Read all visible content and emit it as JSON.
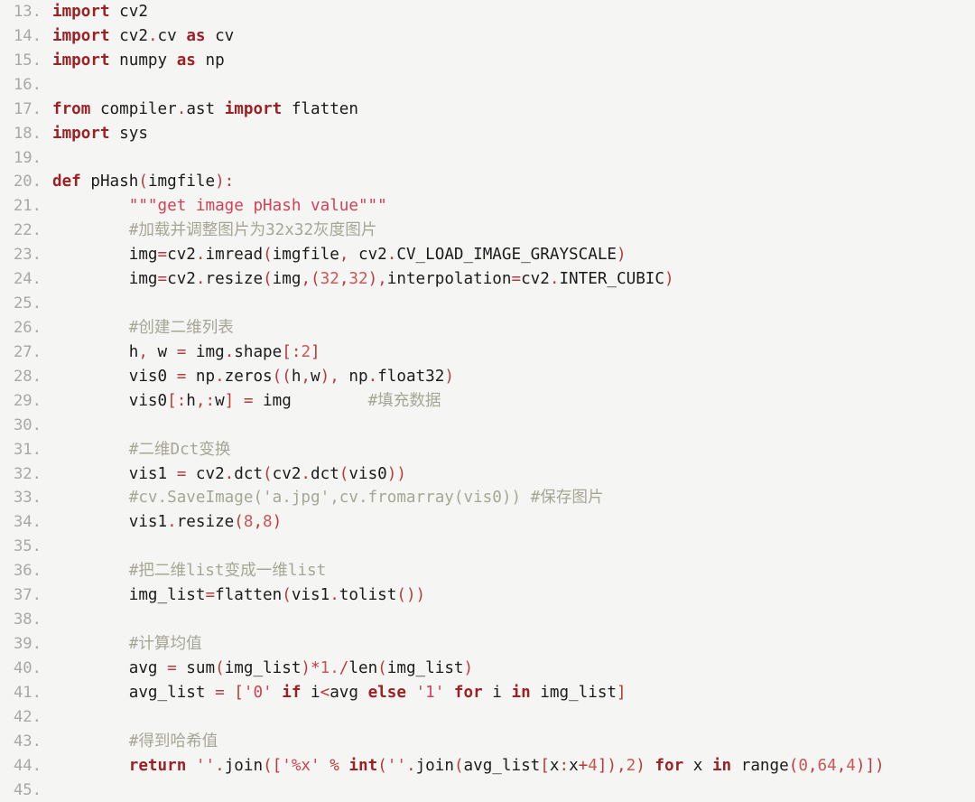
{
  "editor": {
    "language": "python",
    "background_color": "#f5f5f4",
    "line_number_color": "#a8a8a8",
    "keyword_color": "#9c2125",
    "string_color": "#cf4256",
    "comment_color": "#a6a695",
    "number_color": "#cc5555",
    "operator_color": "#b83b3b",
    "plain_color": "#1b1b1b",
    "first_line_number": 13,
    "last_line_number": 45
  },
  "lines": [
    {
      "n": "13.",
      "tokens": [
        {
          "t": "kw",
          "v": "import"
        },
        {
          "t": "pl",
          "v": " cv2"
        }
      ]
    },
    {
      "n": "14.",
      "tokens": [
        {
          "t": "kw",
          "v": "import"
        },
        {
          "t": "pl",
          "v": " cv2"
        },
        {
          "t": "op",
          "v": "."
        },
        {
          "t": "pl",
          "v": "cv "
        },
        {
          "t": "kw",
          "v": "as"
        },
        {
          "t": "pl",
          "v": " cv"
        }
      ]
    },
    {
      "n": "15.",
      "tokens": [
        {
          "t": "kw",
          "v": "import"
        },
        {
          "t": "pl",
          "v": " numpy "
        },
        {
          "t": "kw",
          "v": "as"
        },
        {
          "t": "pl",
          "v": " np"
        }
      ]
    },
    {
      "n": "16.",
      "tokens": []
    },
    {
      "n": "17.",
      "tokens": [
        {
          "t": "kw",
          "v": "from"
        },
        {
          "t": "pl",
          "v": " compiler"
        },
        {
          "t": "op",
          "v": "."
        },
        {
          "t": "pl",
          "v": "ast "
        },
        {
          "t": "kw",
          "v": "import"
        },
        {
          "t": "pl",
          "v": " flatten"
        }
      ]
    },
    {
      "n": "18.",
      "tokens": [
        {
          "t": "kw",
          "v": "import"
        },
        {
          "t": "pl",
          "v": " sys"
        }
      ]
    },
    {
      "n": "19.",
      "tokens": []
    },
    {
      "n": "20.",
      "tokens": [
        {
          "t": "kw",
          "v": "def"
        },
        {
          "t": "pl",
          "v": " pHash"
        },
        {
          "t": "op",
          "v": "("
        },
        {
          "t": "pl",
          "v": "imgfile"
        },
        {
          "t": "op",
          "v": "):"
        }
      ]
    },
    {
      "n": "21.",
      "tokens": [
        {
          "t": "pl",
          "v": "        "
        },
        {
          "t": "str",
          "v": "\"\"\"get image pHash value\"\"\""
        }
      ]
    },
    {
      "n": "22.",
      "tokens": [
        {
          "t": "pl",
          "v": "        "
        },
        {
          "t": "cmt",
          "v": "#加载并调整图片为32x32灰度图片"
        }
      ]
    },
    {
      "n": "23.",
      "tokens": [
        {
          "t": "pl",
          "v": "        img"
        },
        {
          "t": "op",
          "v": "="
        },
        {
          "t": "pl",
          "v": "cv2"
        },
        {
          "t": "op",
          "v": "."
        },
        {
          "t": "pl",
          "v": "imread"
        },
        {
          "t": "op",
          "v": "("
        },
        {
          "t": "pl",
          "v": "imgfile"
        },
        {
          "t": "op",
          "v": ","
        },
        {
          "t": "pl",
          "v": " cv2"
        },
        {
          "t": "op",
          "v": "."
        },
        {
          "t": "pl",
          "v": "CV_LOAD_IMAGE_GRAYSCALE"
        },
        {
          "t": "op",
          "v": ")"
        }
      ]
    },
    {
      "n": "24.",
      "tokens": [
        {
          "t": "pl",
          "v": "        img"
        },
        {
          "t": "op",
          "v": "="
        },
        {
          "t": "pl",
          "v": "cv2"
        },
        {
          "t": "op",
          "v": "."
        },
        {
          "t": "pl",
          "v": "resize"
        },
        {
          "t": "op",
          "v": "("
        },
        {
          "t": "pl",
          "v": "img"
        },
        {
          "t": "op",
          "v": ",("
        },
        {
          "t": "num",
          "v": "32"
        },
        {
          "t": "op",
          "v": ","
        },
        {
          "t": "num",
          "v": "32"
        },
        {
          "t": "op",
          "v": "),"
        },
        {
          "t": "pl",
          "v": "interpolation"
        },
        {
          "t": "op",
          "v": "="
        },
        {
          "t": "pl",
          "v": "cv2"
        },
        {
          "t": "op",
          "v": "."
        },
        {
          "t": "pl",
          "v": "INTER_CUBIC"
        },
        {
          "t": "op",
          "v": ")"
        }
      ]
    },
    {
      "n": "25.",
      "tokens": []
    },
    {
      "n": "26.",
      "tokens": [
        {
          "t": "pl",
          "v": "        "
        },
        {
          "t": "cmt",
          "v": "#创建二维列表"
        }
      ]
    },
    {
      "n": "27.",
      "tokens": [
        {
          "t": "pl",
          "v": "        h"
        },
        {
          "t": "op",
          "v": ","
        },
        {
          "t": "pl",
          "v": " w "
        },
        {
          "t": "op",
          "v": "="
        },
        {
          "t": "pl",
          "v": " img"
        },
        {
          "t": "op",
          "v": "."
        },
        {
          "t": "pl",
          "v": "shape"
        },
        {
          "t": "op",
          "v": "["
        },
        {
          "t": "op",
          "v": ":"
        },
        {
          "t": "num",
          "v": "2"
        },
        {
          "t": "op",
          "v": "]"
        }
      ]
    },
    {
      "n": "28.",
      "tokens": [
        {
          "t": "pl",
          "v": "        vis0 "
        },
        {
          "t": "op",
          "v": "="
        },
        {
          "t": "pl",
          "v": " np"
        },
        {
          "t": "op",
          "v": "."
        },
        {
          "t": "pl",
          "v": "zeros"
        },
        {
          "t": "op",
          "v": "(("
        },
        {
          "t": "pl",
          "v": "h"
        },
        {
          "t": "op",
          "v": ","
        },
        {
          "t": "pl",
          "v": "w"
        },
        {
          "t": "op",
          "v": "),"
        },
        {
          "t": "pl",
          "v": " np"
        },
        {
          "t": "op",
          "v": "."
        },
        {
          "t": "pl",
          "v": "float32"
        },
        {
          "t": "op",
          "v": ")"
        }
      ]
    },
    {
      "n": "29.",
      "tokens": [
        {
          "t": "pl",
          "v": "        vis0"
        },
        {
          "t": "op",
          "v": "[:"
        },
        {
          "t": "pl",
          "v": "h"
        },
        {
          "t": "op",
          "v": ",:"
        },
        {
          "t": "pl",
          "v": "w"
        },
        {
          "t": "op",
          "v": "] ="
        },
        {
          "t": "pl",
          "v": " img        "
        },
        {
          "t": "cmt",
          "v": "#填充数据"
        }
      ]
    },
    {
      "n": "30.",
      "tokens": []
    },
    {
      "n": "31.",
      "tokens": [
        {
          "t": "pl",
          "v": "        "
        },
        {
          "t": "cmt",
          "v": "#二维Dct变换"
        }
      ]
    },
    {
      "n": "32.",
      "tokens": [
        {
          "t": "pl",
          "v": "        vis1 "
        },
        {
          "t": "op",
          "v": "="
        },
        {
          "t": "pl",
          "v": " cv2"
        },
        {
          "t": "op",
          "v": "."
        },
        {
          "t": "pl",
          "v": "dct"
        },
        {
          "t": "op",
          "v": "("
        },
        {
          "t": "pl",
          "v": "cv2"
        },
        {
          "t": "op",
          "v": "."
        },
        {
          "t": "pl",
          "v": "dct"
        },
        {
          "t": "op",
          "v": "("
        },
        {
          "t": "pl",
          "v": "vis0"
        },
        {
          "t": "op",
          "v": "))"
        }
      ]
    },
    {
      "n": "33.",
      "tokens": [
        {
          "t": "pl",
          "v": "        "
        },
        {
          "t": "cmt",
          "v": "#cv.SaveImage('a.jpg',cv.fromarray(vis0)) #保存图片"
        }
      ]
    },
    {
      "n": "34.",
      "tokens": [
        {
          "t": "pl",
          "v": "        vis1"
        },
        {
          "t": "op",
          "v": "."
        },
        {
          "t": "pl",
          "v": "resize"
        },
        {
          "t": "op",
          "v": "("
        },
        {
          "t": "num",
          "v": "8"
        },
        {
          "t": "op",
          "v": ","
        },
        {
          "t": "num",
          "v": "8"
        },
        {
          "t": "op",
          "v": ")"
        }
      ]
    },
    {
      "n": "35.",
      "tokens": []
    },
    {
      "n": "36.",
      "tokens": [
        {
          "t": "pl",
          "v": "        "
        },
        {
          "t": "cmt",
          "v": "#把二维list变成一维list"
        }
      ]
    },
    {
      "n": "37.",
      "tokens": [
        {
          "t": "pl",
          "v": "        img_list"
        },
        {
          "t": "op",
          "v": "="
        },
        {
          "t": "pl",
          "v": "flatten"
        },
        {
          "t": "op",
          "v": "("
        },
        {
          "t": "pl",
          "v": "vis1"
        },
        {
          "t": "op",
          "v": "."
        },
        {
          "t": "pl",
          "v": "tolist"
        },
        {
          "t": "op",
          "v": "())"
        }
      ]
    },
    {
      "n": "38.",
      "tokens": []
    },
    {
      "n": "39.",
      "tokens": [
        {
          "t": "pl",
          "v": "        "
        },
        {
          "t": "cmt",
          "v": "#计算均值"
        }
      ]
    },
    {
      "n": "40.",
      "tokens": [
        {
          "t": "pl",
          "v": "        avg "
        },
        {
          "t": "op",
          "v": "="
        },
        {
          "t": "pl",
          "v": " sum"
        },
        {
          "t": "op",
          "v": "("
        },
        {
          "t": "pl",
          "v": "img_list"
        },
        {
          "t": "op",
          "v": ")*"
        },
        {
          "t": "num",
          "v": "1."
        },
        {
          "t": "op",
          "v": "/"
        },
        {
          "t": "pl",
          "v": "len"
        },
        {
          "t": "op",
          "v": "("
        },
        {
          "t": "pl",
          "v": "img_list"
        },
        {
          "t": "op",
          "v": ")"
        }
      ]
    },
    {
      "n": "41.",
      "tokens": [
        {
          "t": "pl",
          "v": "        avg_list "
        },
        {
          "t": "op",
          "v": "="
        },
        {
          "t": "pl",
          "v": " "
        },
        {
          "t": "op",
          "v": "["
        },
        {
          "t": "str",
          "v": "'0'"
        },
        {
          "t": "pl",
          "v": " "
        },
        {
          "t": "kw",
          "v": "if"
        },
        {
          "t": "pl",
          "v": " i"
        },
        {
          "t": "op",
          "v": "<"
        },
        {
          "t": "pl",
          "v": "avg "
        },
        {
          "t": "kw",
          "v": "else"
        },
        {
          "t": "pl",
          "v": " "
        },
        {
          "t": "str",
          "v": "'1'"
        },
        {
          "t": "pl",
          "v": " "
        },
        {
          "t": "kw",
          "v": "for"
        },
        {
          "t": "pl",
          "v": " i "
        },
        {
          "t": "kw",
          "v": "in"
        },
        {
          "t": "pl",
          "v": " img_list"
        },
        {
          "t": "op",
          "v": "]"
        }
      ]
    },
    {
      "n": "42.",
      "tokens": []
    },
    {
      "n": "43.",
      "tokens": [
        {
          "t": "pl",
          "v": "        "
        },
        {
          "t": "cmt",
          "v": "#得到哈希值"
        }
      ]
    },
    {
      "n": "44.",
      "tokens": [
        {
          "t": "pl",
          "v": "        "
        },
        {
          "t": "kw",
          "v": "return"
        },
        {
          "t": "pl",
          "v": " "
        },
        {
          "t": "str",
          "v": "''"
        },
        {
          "t": "op",
          "v": "."
        },
        {
          "t": "pl",
          "v": "join"
        },
        {
          "t": "op",
          "v": "(["
        },
        {
          "t": "str",
          "v": "'%x'"
        },
        {
          "t": "pl",
          "v": " "
        },
        {
          "t": "op",
          "v": "%"
        },
        {
          "t": "pl",
          "v": " "
        },
        {
          "t": "kw",
          "v": "int"
        },
        {
          "t": "op",
          "v": "("
        },
        {
          "t": "str",
          "v": "''"
        },
        {
          "t": "op",
          "v": "."
        },
        {
          "t": "pl",
          "v": "join"
        },
        {
          "t": "op",
          "v": "("
        },
        {
          "t": "pl",
          "v": "avg_list"
        },
        {
          "t": "op",
          "v": "["
        },
        {
          "t": "pl",
          "v": "x"
        },
        {
          "t": "op",
          "v": ":"
        },
        {
          "t": "pl",
          "v": "x"
        },
        {
          "t": "op",
          "v": "+"
        },
        {
          "t": "num",
          "v": "4"
        },
        {
          "t": "op",
          "v": "]),"
        },
        {
          "t": "num",
          "v": "2"
        },
        {
          "t": "op",
          "v": ")"
        },
        {
          "t": "pl",
          "v": " "
        },
        {
          "t": "kw",
          "v": "for"
        },
        {
          "t": "pl",
          "v": " x "
        },
        {
          "t": "kw",
          "v": "in"
        },
        {
          "t": "pl",
          "v": " range"
        },
        {
          "t": "op",
          "v": "("
        },
        {
          "t": "num",
          "v": "0"
        },
        {
          "t": "op",
          "v": ","
        },
        {
          "t": "num",
          "v": "64"
        },
        {
          "t": "op",
          "v": ","
        },
        {
          "t": "num",
          "v": "4"
        },
        {
          "t": "op",
          "v": ")])"
        }
      ]
    },
    {
      "n": "45.",
      "tokens": []
    }
  ]
}
